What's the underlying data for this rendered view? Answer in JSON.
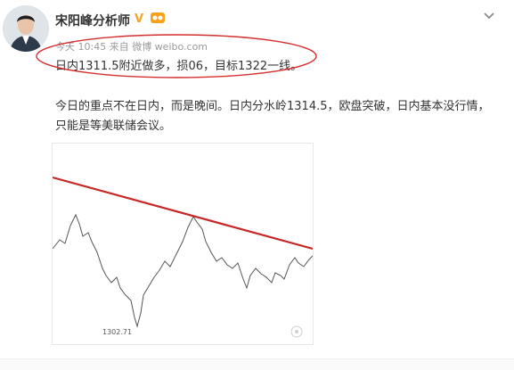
{
  "author": {
    "name": "宋阳峰分析师",
    "verified_badge": "V",
    "avatar_icon": "person-avatar-icon"
  },
  "post": {
    "meta": "今天 10:45 来自 微博 weibo.com",
    "line1": "日内1311.5附近做多，损06，目标1322一线。",
    "body": "今日的重点不在日内，而是晚间。日内分水岭1314.5，欧盘突破，日内基本没行情，只能是等美联储会议。"
  },
  "chart_data": {
    "type": "line",
    "annotations": [
      "1302.71"
    ],
    "colors": {
      "price": "#555555",
      "trendline": "#c62828"
    }
  },
  "colors": {
    "circle": "#d32f2f",
    "vbadge": "#f5a623"
  }
}
